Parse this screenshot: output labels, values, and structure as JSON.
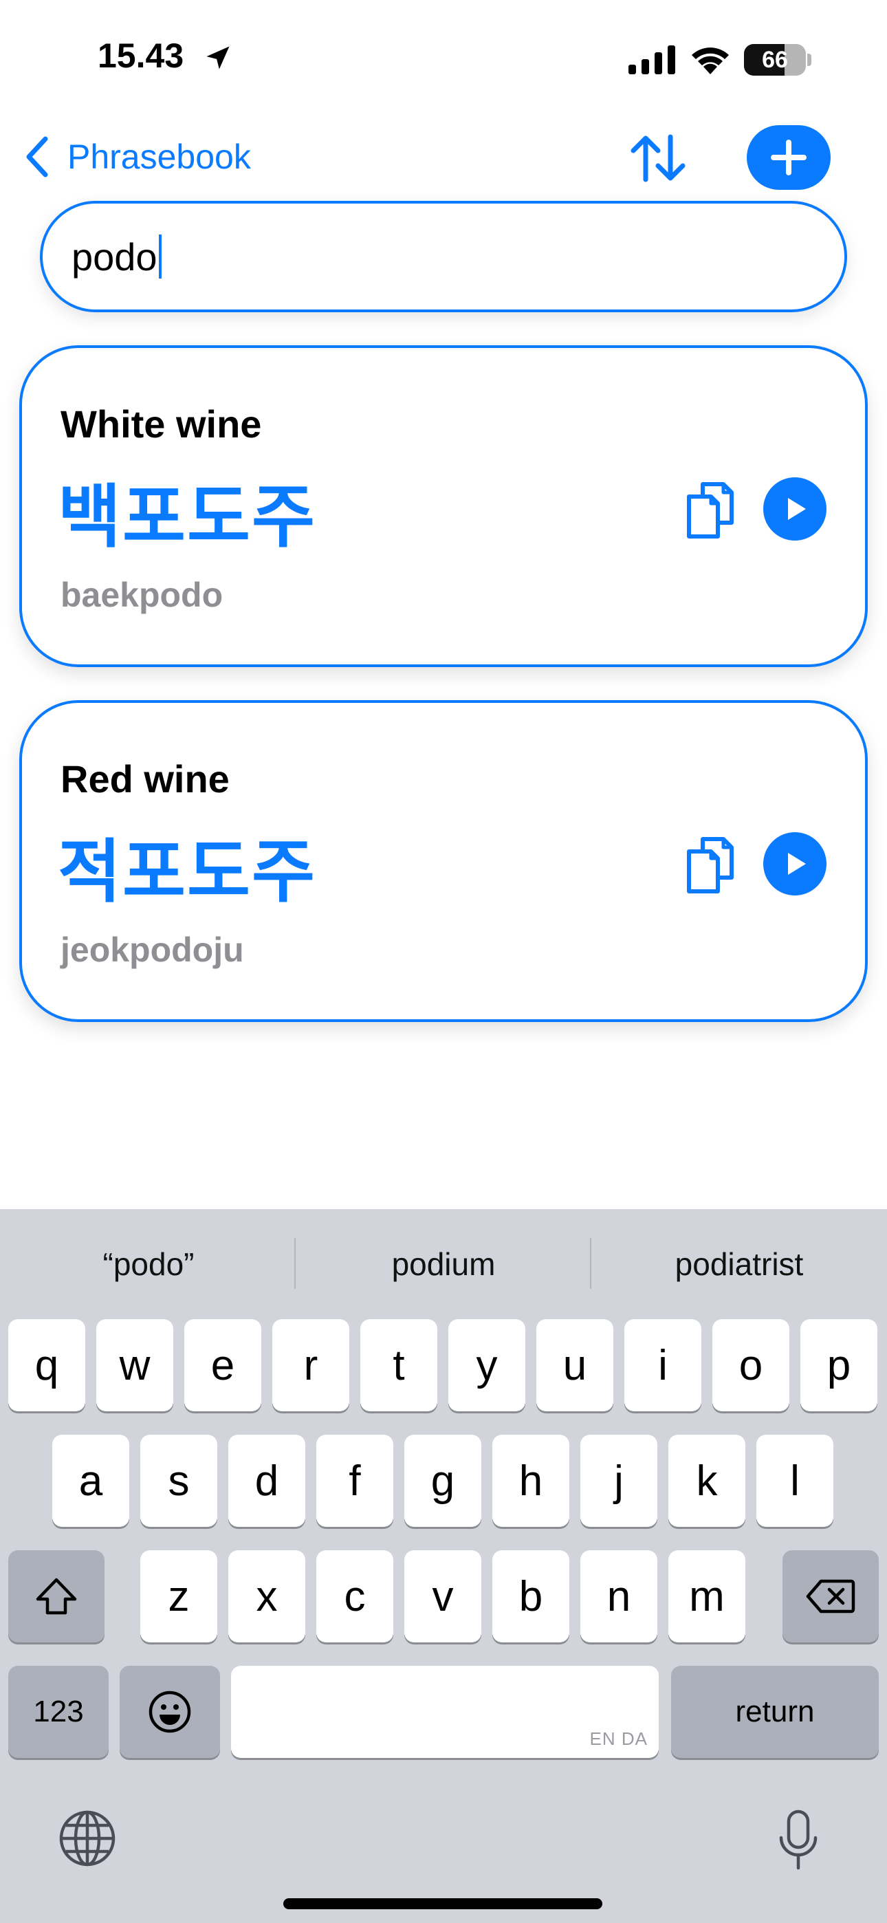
{
  "status_bar": {
    "time": "15.43",
    "battery_percent": "66",
    "battery_level": 0.66,
    "location_icon": "location-arrow-icon",
    "signal_icon": "cellular-signal-icon",
    "wifi_icon": "wifi-icon"
  },
  "nav": {
    "back_label": "Phrasebook",
    "back_icon": "chevron-left-icon",
    "sort_icon": "sort-arrows-icon",
    "add_icon": "plus-icon"
  },
  "search": {
    "value": "podo"
  },
  "results": [
    {
      "title": "White wine",
      "korean": "백포도주",
      "romanization": "baekpodo"
    },
    {
      "title": "Red wine",
      "korean": "적포도주",
      "romanization": "jeokpodoju"
    }
  ],
  "keyboard": {
    "suggestions": [
      "“podo”",
      "podium",
      "podiatrist"
    ],
    "row1": [
      "q",
      "w",
      "e",
      "r",
      "t",
      "y",
      "u",
      "i",
      "o",
      "p"
    ],
    "row2": [
      "a",
      "s",
      "d",
      "f",
      "g",
      "h",
      "j",
      "k",
      "l"
    ],
    "row3": [
      "z",
      "x",
      "c",
      "v",
      "b",
      "n",
      "m"
    ],
    "numbers_label": "123",
    "return_label": "return",
    "space_tag": "EN DA"
  },
  "colors": {
    "accent": "#0a7aff",
    "secondary_text": "#8e8e93",
    "keyboard_bg": "#d1d4db"
  }
}
